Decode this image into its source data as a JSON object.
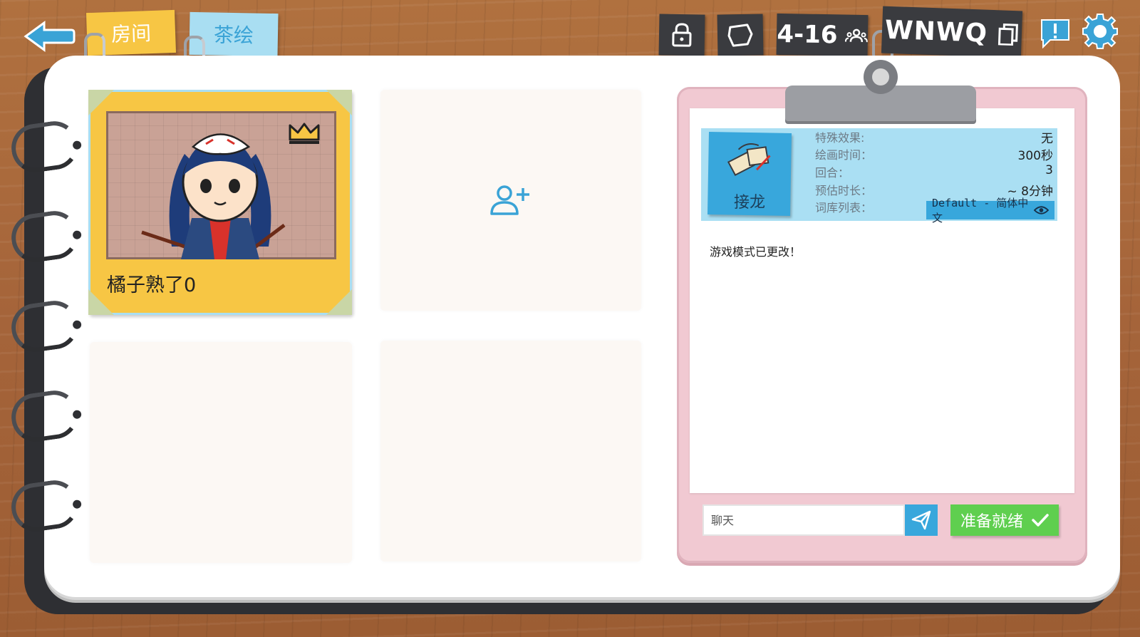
{
  "tabs": {
    "room": "房间",
    "draw": "茶绘"
  },
  "toolbar": {
    "players": "4-16",
    "room_code": "WNWQ"
  },
  "players": [
    {
      "name": "橘子熟了0",
      "is_host": true
    },
    {
      "name": ""
    },
    {
      "name": ""
    },
    {
      "name": ""
    }
  ],
  "mode": {
    "name": "接龙"
  },
  "settings": {
    "effect_label": "特殊效果:",
    "effect_value": "无",
    "draw_time_label": "绘画时间：",
    "draw_time_value": "300秒",
    "rounds_label": "回合：",
    "rounds_value": "3",
    "duration_label": "预估时长：",
    "duration_value": "~ 8分钟",
    "wordlist_label": "词库列表：",
    "wordlist_value": "Default - 简体中文"
  },
  "chat": {
    "messages": [
      "游戏模式已更改！"
    ],
    "placeholder": "聊天"
  },
  "ready_label": "准备就绪",
  "colors": {
    "yellow": "#f7c644",
    "blue": "#38a7dc",
    "green": "#5fcf4f",
    "pink": "#f1c9d2"
  }
}
